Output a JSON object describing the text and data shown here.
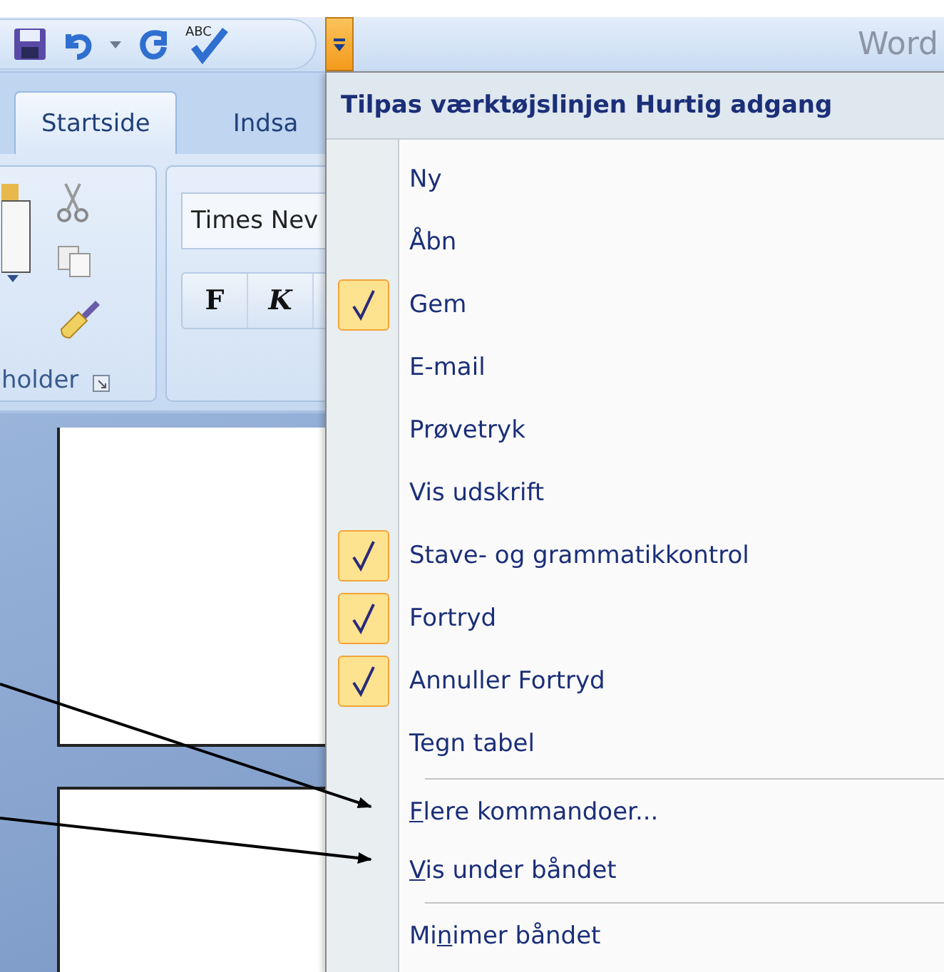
{
  "title_bar": {
    "app_name": "Word"
  },
  "quick_access_toolbar": {
    "spelling_icon_text": "ABC",
    "customize_button_pressed": true
  },
  "tabs": [
    {
      "label": "Startside",
      "selected": true
    },
    {
      "label": "Indsa",
      "selected": false
    }
  ],
  "ribbon": {
    "clipboard_group": {
      "label": "holder"
    },
    "font_group": {
      "font_name": "Times Nev",
      "buttons": [
        "F",
        "K"
      ]
    }
  },
  "menu": {
    "title": "Tilpas værktøjslinjen Hurtig adgang",
    "checkable_items": [
      {
        "label": "Ny",
        "checked": false
      },
      {
        "label": "Åbn",
        "checked": false
      },
      {
        "label": "Gem",
        "checked": true
      },
      {
        "label": "E-mail",
        "checked": false
      },
      {
        "label": "Prøvetryk",
        "checked": false
      },
      {
        "label": "Vis udskrift",
        "checked": false
      },
      {
        "label": "Stave- og grammatikkontrol",
        "checked": true
      },
      {
        "label": "Fortryd",
        "checked": true
      },
      {
        "label": "Annuller Fortryd",
        "checked": true
      },
      {
        "label": "Tegn tabel",
        "checked": false
      }
    ],
    "commands": [
      {
        "access_key": "F",
        "after": "lere kommandoer..."
      },
      {
        "access_key": "V",
        "after": "is under båndet"
      }
    ],
    "ribbon_commands": [
      {
        "before": "Mi",
        "access_key": "n",
        "after": "imer båndet"
      }
    ]
  }
}
